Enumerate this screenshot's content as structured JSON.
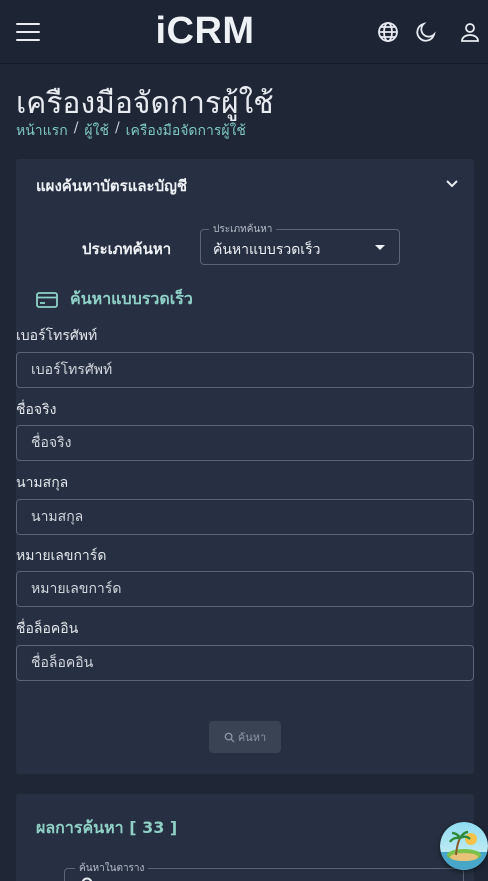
{
  "appbar": {
    "title": "iCRM",
    "menu_icon": "hamburger-menu-icon",
    "language_icon": "globe-icon",
    "theme_icon": "moon-icon",
    "account_icon": "user-icon"
  },
  "page": {
    "title": "เครืองมือจัดการผู้ใช้",
    "breadcrumb": [
      "หน้าแรก",
      "ผู้ใช้",
      "เครืองมือจัดการผู้ใช้"
    ]
  },
  "search_panel": {
    "title": "แผงค้นหาบัตรและบัญชี",
    "type_label": "ประเภทค้นหา",
    "type_select": {
      "legend": "ประเภทค้นหา",
      "value": "ค้นหาแบบรวดเร็ว"
    },
    "quick_title": "ค้นหาแบบรวดเร็ว",
    "fields": [
      {
        "label": "เบอร์โทรศัพท์",
        "placeholder": "เบอร์โทรศัพท์"
      },
      {
        "label": "ชื่อจริง",
        "placeholder": "ชื่อจริง"
      },
      {
        "label": "นามสกุล",
        "placeholder": "นามสกุล"
      },
      {
        "label": "หมายเลขการ์ด",
        "placeholder": "หมายเลขการ์ด"
      },
      {
        "label": "ชื่อล็อคอิน",
        "placeholder": "ชื่อล็อคอิน"
      }
    ],
    "search_button": "ค้นหา"
  },
  "results": {
    "title": "ผลการค้นหา [ 33 ]",
    "table_search_legend": "ค้นหาในตาราง"
  },
  "colors": {
    "accent": "#8fd1c7",
    "background": "#1f2636",
    "panel": "#273042"
  }
}
